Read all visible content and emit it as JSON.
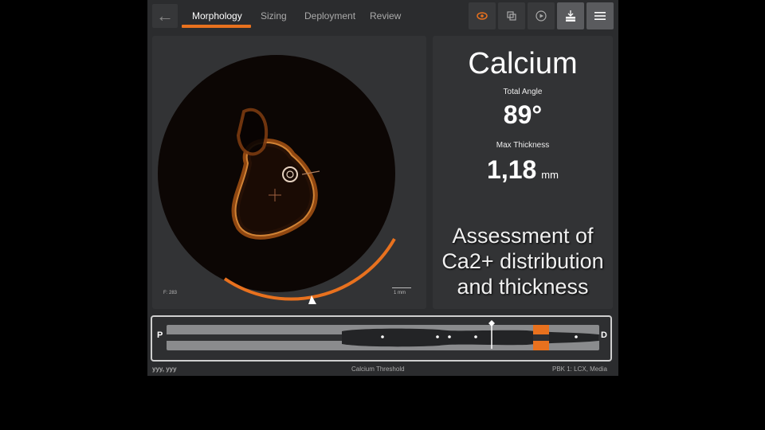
{
  "header": {
    "tabs": [
      {
        "label": "Morphology",
        "active": true
      },
      {
        "label": "Sizing"
      },
      {
        "label": "Deployment"
      },
      {
        "label": "Review"
      }
    ],
    "toolbar_icons": [
      "eye-icon",
      "copy-icon",
      "play-icon",
      "stack-export-icon",
      "menu-icon"
    ]
  },
  "image": {
    "frame_label": "F: 283",
    "scale_label": "1 mm"
  },
  "result": {
    "title": "Calcium",
    "angle_label": "Total Angle",
    "angle_value": "89°",
    "thickness_label": "Max Thickness",
    "thickness_value": "1,18",
    "thickness_unit": "mm",
    "note_lines": [
      "Assessment of",
      "Ca2+ distribution",
      "and thickness"
    ]
  },
  "longitudinal": {
    "proximal_label": "P",
    "distal_label": "D"
  },
  "status": {
    "left": "yyy, yyy",
    "center": "Calcium Threshold",
    "right": "PBK 1:  LCX,  Media"
  },
  "colors": {
    "accent": "#e8711e",
    "background": "#2b2c2e",
    "panel": "#323335"
  }
}
